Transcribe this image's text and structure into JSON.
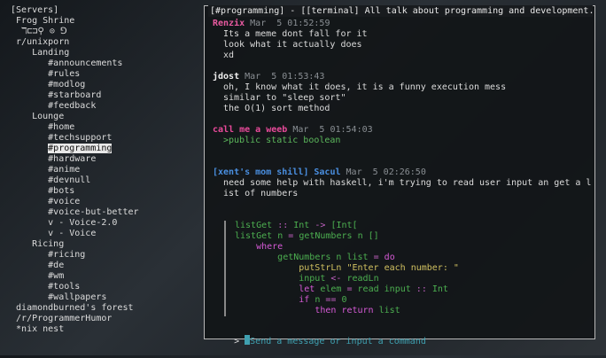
{
  "sidebar": {
    "items": [
      {
        "label": "[Servers]",
        "indent": 0
      },
      {
        "label": "Frog Shrine",
        "indent": 1
      },
      {
        "label": "ℸ⊏⊐⚲ ⊙ ⅁",
        "indent": 2
      },
      {
        "label": "r/unixporn",
        "indent": 1
      },
      {
        "label": "Landing",
        "indent": 4
      },
      {
        "label": "#announcements",
        "indent": 7
      },
      {
        "label": "#rules",
        "indent": 7
      },
      {
        "label": "#modlog",
        "indent": 7
      },
      {
        "label": "#starboard",
        "indent": 7
      },
      {
        "label": "#feedback",
        "indent": 7
      },
      {
        "label": "Lounge",
        "indent": 4
      },
      {
        "label": "#home",
        "indent": 7
      },
      {
        "label": "#techsupport",
        "indent": 7
      },
      {
        "label": "#programming",
        "indent": 7,
        "selected": true
      },
      {
        "label": "#hardware",
        "indent": 7
      },
      {
        "label": "#anime",
        "indent": 7
      },
      {
        "label": "#devnull",
        "indent": 7
      },
      {
        "label": "#bots",
        "indent": 7
      },
      {
        "label": "#voice",
        "indent": 7
      },
      {
        "label": "#voice-but-better",
        "indent": 7
      },
      {
        "label": "v - Voice-2.0",
        "indent": 7
      },
      {
        "label": "v - Voice",
        "indent": 7
      },
      {
        "label": "Ricing",
        "indent": 4
      },
      {
        "label": "#ricing",
        "indent": 7
      },
      {
        "label": "#de",
        "indent": 7
      },
      {
        "label": "#wm",
        "indent": 7
      },
      {
        "label": "#tools",
        "indent": 7
      },
      {
        "label": "#wallpapers",
        "indent": 7
      },
      {
        "label": "diamondburned's forest",
        "indent": 1
      },
      {
        "label": "/r/ProgrammerHumor",
        "indent": 1
      },
      {
        "label": "*nix nest",
        "indent": 1
      }
    ]
  },
  "panel": {
    "title": "[#programming] - [[terminal] All talk about programming and development.]"
  },
  "messages": [
    {
      "nick": "Renzix",
      "nick_color": "#e85aa0",
      "time": "Mar  5 01:52:59",
      "lines": [
        "Its a meme dont fall for it",
        "look what it actually does",
        "xd"
      ],
      "line_color": "#dcdcdc"
    },
    {
      "nick": "jdost",
      "nick_color": "#f0f0f0",
      "time": "Mar  5 01:53:43",
      "lines": [
        "oh, I know what it does, it is a funny execution mess",
        "similar to \"sleep sort\"",
        "the O(1) sort method"
      ],
      "line_color": "#dcdcdc"
    },
    {
      "nick": "call me a weeb",
      "nick_color": "#e84a9a",
      "time": "Mar  5 01:54:03",
      "lines": [
        ">public static boolean"
      ],
      "line_color": "#5cb85c"
    },
    {
      "nick": "[xent's mom shill] Sacul",
      "nick_color": "#4a8fe0",
      "time": "Mar  5 02:26:50",
      "lines": [
        "need some help with haskell, i'm trying to read user input an get a l",
        "ist of numbers"
      ],
      "line_color": "#dcdcdc"
    }
  ],
  "code_block": [
    {
      "text": "listGet :: Int -> [Int[",
      "indent": 0
    },
    {
      "text": "listGet n = getNumbers n []",
      "indent": 0
    },
    {
      "text": "where",
      "indent": 4
    },
    {
      "text": "getNumbers n list = do",
      "indent": 8
    },
    {
      "text": "putStrLn \"Enter each number: \"",
      "indent": 12
    },
    {
      "text": "input <- readLn",
      "indent": 12
    },
    {
      "text": "let elem = read input :: Int",
      "indent": 12
    },
    {
      "text": "if n == 0",
      "indent": 12
    },
    {
      "text": "then return list",
      "indent": 15
    }
  ],
  "input": {
    "prompt": ">",
    "placeholder": "Send a message or input a command"
  },
  "colors": {
    "code_green": "#4caf50",
    "code_magenta": "#d65ad6",
    "code_yellow": "#d0c060",
    "code_operator": "#c060c0",
    "accent_cyan": "#3fa0b0"
  }
}
